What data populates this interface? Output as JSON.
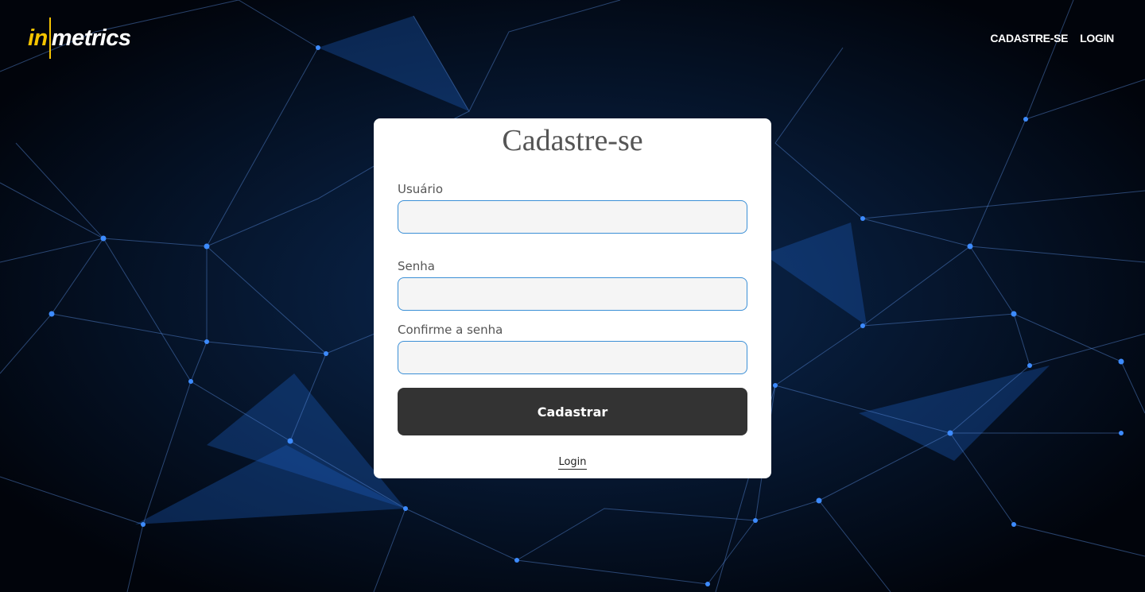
{
  "brand": {
    "logo_in": "in",
    "logo_metrics": "metrics",
    "accent_color": "#f5c400"
  },
  "nav": {
    "signup_label": "CADASTRE-SE",
    "login_label": "LOGIN"
  },
  "form": {
    "title": "Cadastre-se",
    "username_label": "Usuário",
    "username_value": "",
    "password_label": "Senha",
    "password_value": "",
    "confirm_label": "Confirme a senha",
    "confirm_value": "",
    "submit_label": "Cadastrar",
    "login_link_label": "Login"
  },
  "background": {
    "description_icon": "network-mesh",
    "base_color": "#02060f",
    "node_color": "#2a7fff"
  }
}
